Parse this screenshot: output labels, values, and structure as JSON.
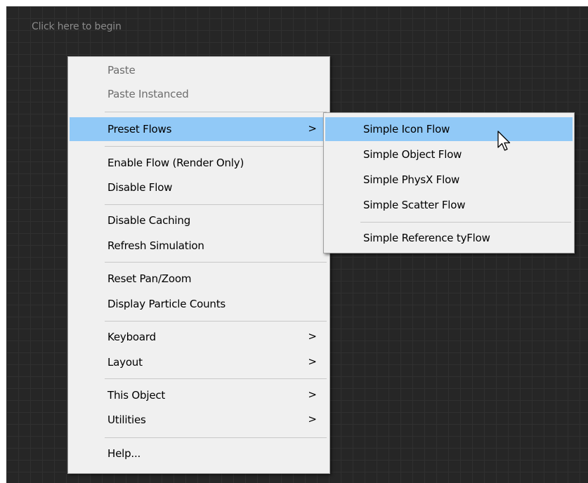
{
  "canvas": {
    "hint_text": "Click here to begin"
  },
  "main_menu": {
    "paste": "Paste",
    "paste_instanced": "Paste Instanced",
    "preset_flows": "Preset Flows",
    "enable_flow": "Enable Flow (Render Only)",
    "disable_flow": "Disable Flow",
    "disable_caching": "Disable Caching",
    "refresh_simulation": "Refresh Simulation",
    "reset_pan_zoom": "Reset Pan/Zoom",
    "display_particle_counts": "Display Particle Counts",
    "keyboard": "Keyboard",
    "layout": "Layout",
    "this_object": "This Object",
    "utilities": "Utilities",
    "help": "Help...",
    "submenu_arrow": ">"
  },
  "preset_flows_menu": {
    "simple_icon_flow": "Simple Icon Flow",
    "simple_object_flow": "Simple Object Flow",
    "simple_physx_flow": "Simple PhysX Flow",
    "simple_scatter_flow": "Simple Scatter Flow",
    "simple_reference_tyflow": "Simple Reference tyFlow"
  },
  "colors": {
    "canvas_bg": "#262626",
    "menu_bg": "#f0f0f0",
    "highlight": "#91c9f7",
    "disabled_text": "#6d6d6d"
  }
}
